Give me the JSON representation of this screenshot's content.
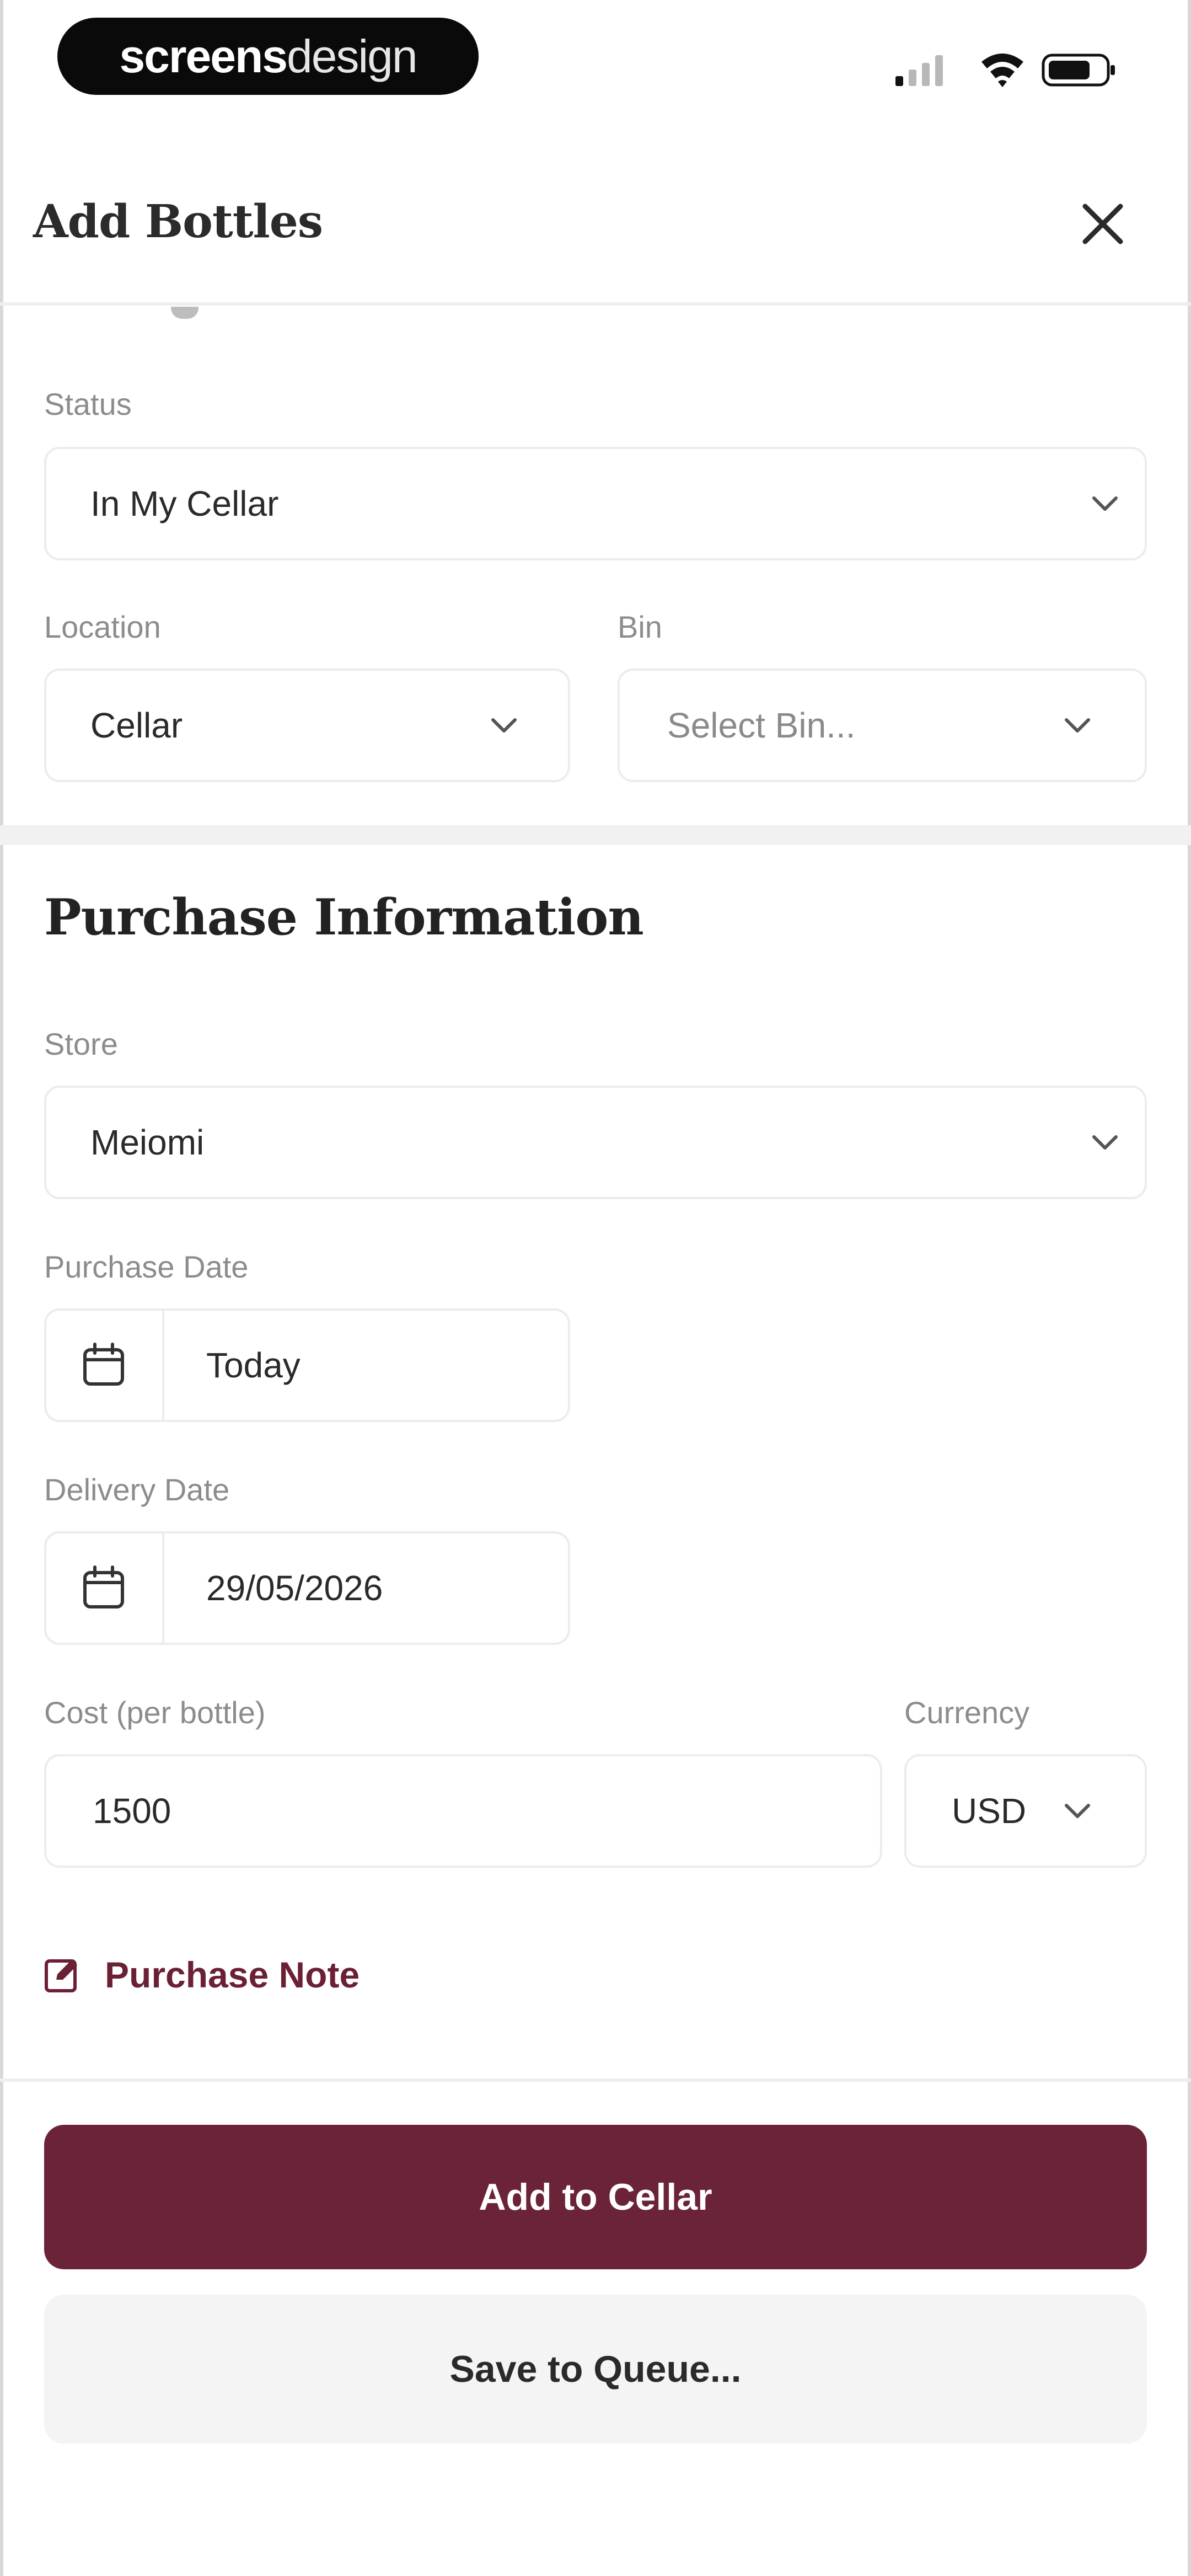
{
  "status_bar": {
    "brand_part1": "screens",
    "brand_part2": "design"
  },
  "header": {
    "title": "Add Bottles"
  },
  "storage": {
    "status": {
      "label": "Status",
      "value": "In My Cellar"
    },
    "location": {
      "label": "Location",
      "value": "Cellar"
    },
    "bin": {
      "label": "Bin",
      "placeholder": "Select Bin..."
    }
  },
  "purchase": {
    "title": "Purchase Information",
    "store": {
      "label": "Store",
      "value": "Meiomi"
    },
    "purchase_date": {
      "label": "Purchase Date",
      "value": "Today"
    },
    "delivery_date": {
      "label": "Delivery Date",
      "value": "29/05/2026"
    },
    "cost": {
      "label": "Cost (per bottle)",
      "value": "1500"
    },
    "currency": {
      "label": "Currency",
      "value": "USD"
    },
    "note_link": "Purchase Note"
  },
  "actions": {
    "primary": "Add to Cellar",
    "secondary": "Save to Queue..."
  },
  "colors": {
    "accent": "#6b2338",
    "accent_text": "#6b2033"
  }
}
